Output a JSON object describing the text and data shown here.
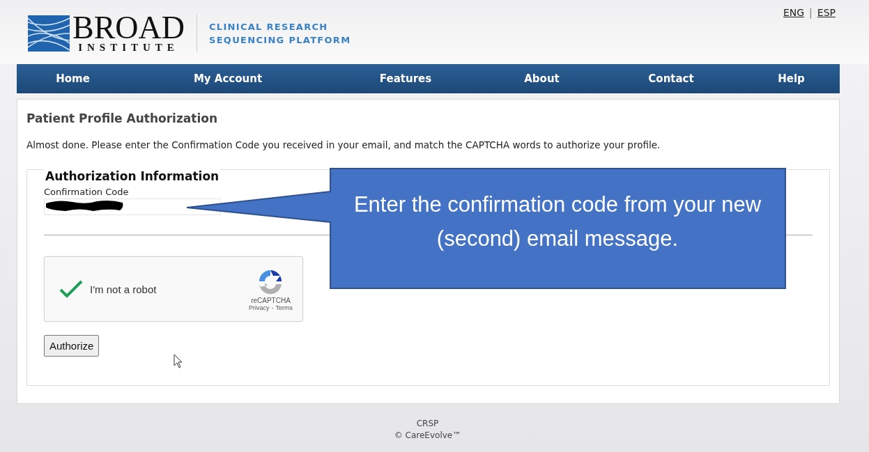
{
  "header": {
    "logo_word": "BROAD",
    "logo_subword": "INSTITUTE",
    "platform_lines": [
      "CLINICAL RESEARCH",
      "SEQUENCING PLATFORM"
    ],
    "languages": [
      {
        "label": "ENG"
      },
      {
        "label": "ESP"
      }
    ],
    "language_separator": "|"
  },
  "nav": [
    {
      "label": "Home"
    },
    {
      "label": "My Account"
    },
    {
      "label": "Features"
    },
    {
      "label": "About"
    },
    {
      "label": "Contact"
    },
    {
      "label": "Help"
    }
  ],
  "page": {
    "title": "Patient Profile Authorization",
    "instructions": "Almost done. Please enter the Confirmation Code you received in your email, and match the CAPTCHA words to authorize your profile.",
    "fieldset": {
      "legend": "Authorization Information",
      "field_label": "Confirmation Code",
      "value_redacted": true
    },
    "captcha": {
      "label": "I'm not a robot",
      "checked": true,
      "brand": "reCAPTCHA",
      "links": [
        "Privacy",
        "Terms"
      ],
      "link_separator": "-"
    },
    "button": "Authorize"
  },
  "callout": {
    "text": "Enter the confirmation code from your new (second) email message."
  },
  "footer": {
    "lines": [
      "CRSP",
      "© CareEvolve™"
    ]
  }
}
